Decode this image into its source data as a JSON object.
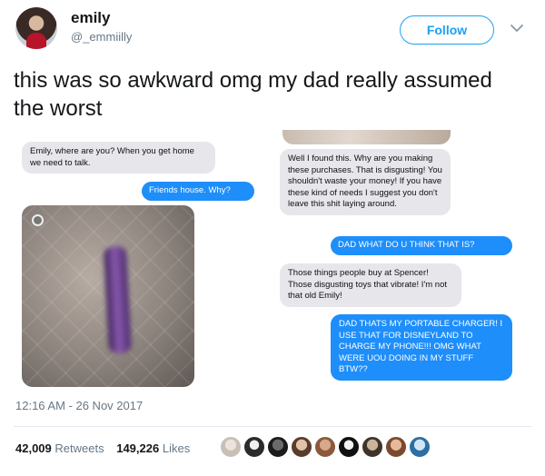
{
  "user": {
    "name": "emily",
    "handle": "@_emmiilly",
    "follow_label": "Follow"
  },
  "tweet": {
    "text": "this was so awkward omg my dad really assumed the worst",
    "timestamp": "12:16 AM - 26 Nov 2017"
  },
  "screenshot": {
    "messages": [
      {
        "side": "left",
        "text": "Emily, where are you? When you get home we need to talk."
      },
      {
        "side": "right",
        "text": "Friends house. Why?"
      },
      {
        "side": "left",
        "text": "Well I found this. Why are you making these purchases. That is disgusting! You shouldn't waste your money! If you have these kind of needs I suggest you don't leave this shit laying around."
      },
      {
        "side": "right",
        "text": "DAD WHAT DO U THINK THAT IS?"
      },
      {
        "side": "left",
        "text": "Those things people buy at Spencer! Those disgusting toys that vibrate! I'm not that old Emily!"
      },
      {
        "side": "right",
        "text": "DAD THATS MY PORTABLE CHARGER! I USE THAT FOR DISNEYLAND TO CHARGE MY PHONE!!! OMG WHAT WERE UOU DOING IN MY STUFF BTW??"
      }
    ]
  },
  "stats": {
    "retweets_count": "42,009",
    "retweets_label": "Retweets",
    "likes_count": "149,226",
    "likes_label": "Likes"
  },
  "colors": {
    "accent": "#1da1f2",
    "imessage_blue": "#1e8efb",
    "imessage_gray": "#e6e6eb"
  }
}
